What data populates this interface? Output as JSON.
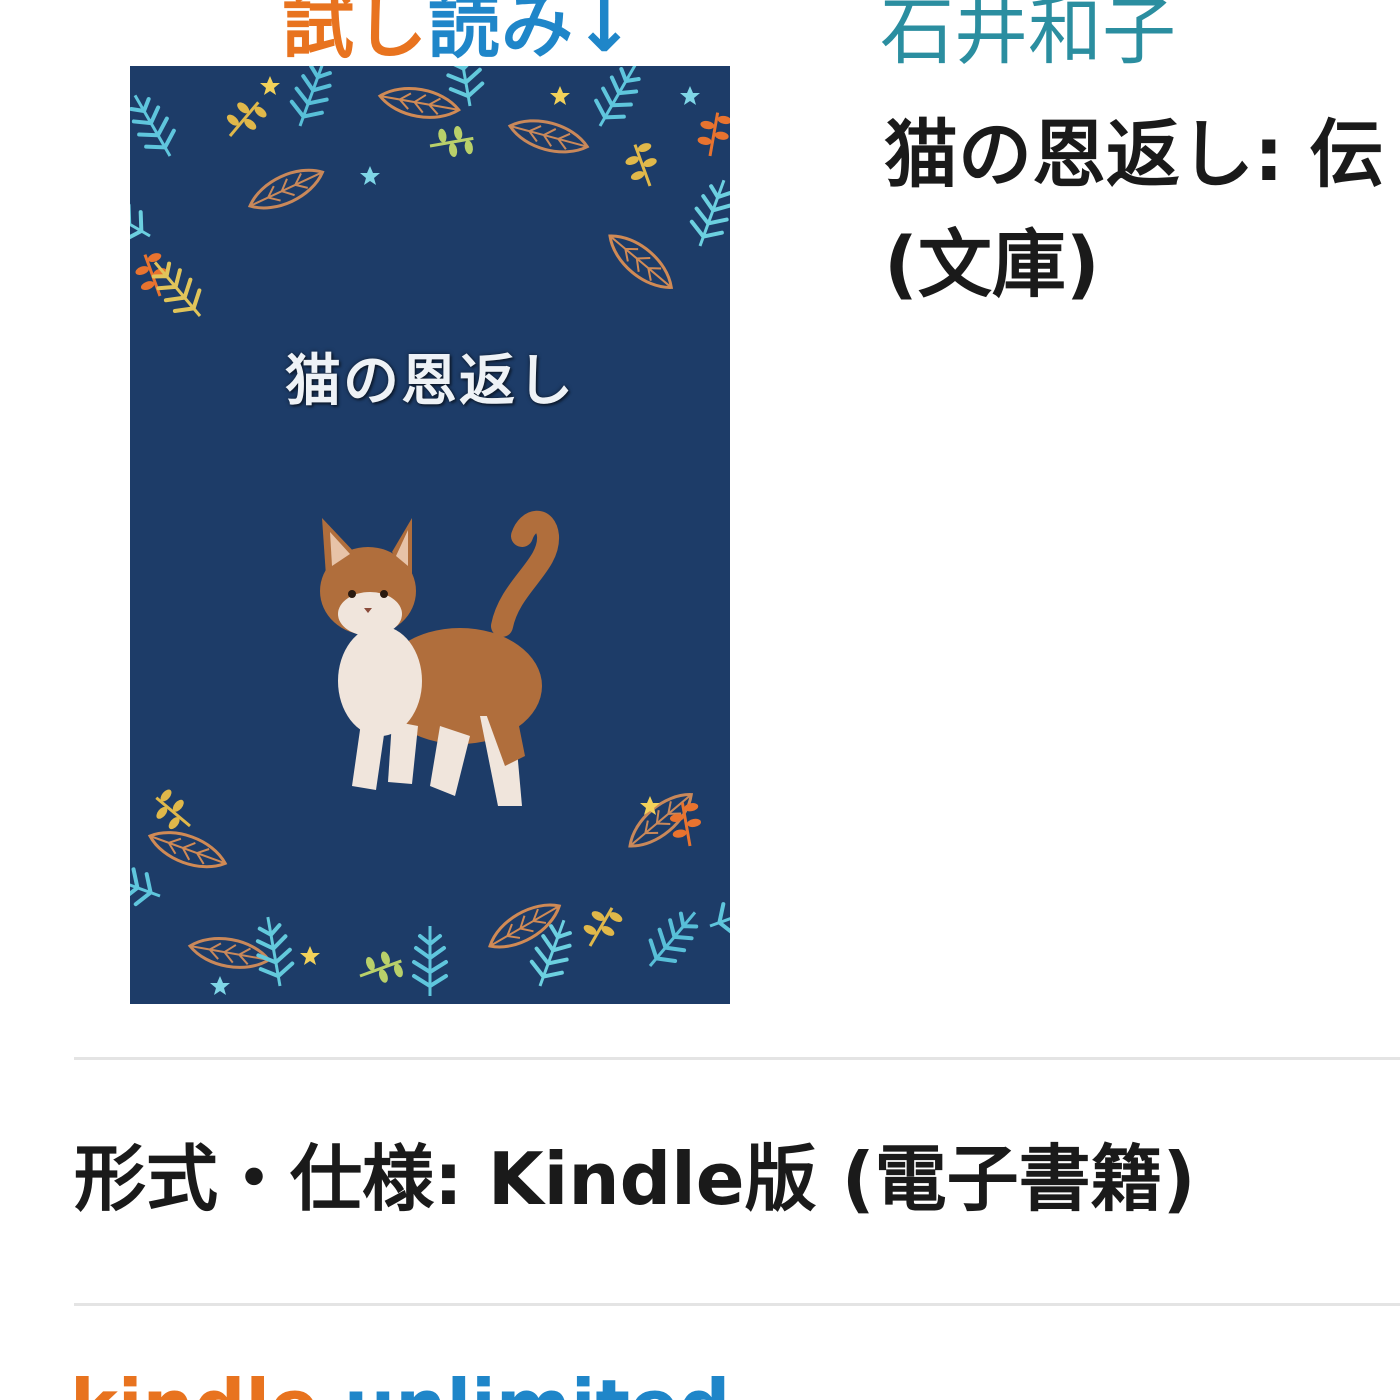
{
  "look_inside": {
    "part1": "試し",
    "part2": "読み",
    "arrow": "↓"
  },
  "cover": {
    "title": "猫の恩返し",
    "background": "#1d3c68"
  },
  "author": "石井和子",
  "book_title": {
    "line1": "猫の恩返し: 伝",
    "line2": "(文庫)"
  },
  "format_spec": "形式・仕様: Kindle版 (電子書籍)",
  "kindle_unlimited": {
    "part1": "kindle",
    "part2": "unlimited"
  },
  "colors": {
    "orange": "#e8731f",
    "blue": "#1f86c9",
    "author_teal": "#2b8ea0",
    "divider": "#e4e4e4"
  }
}
